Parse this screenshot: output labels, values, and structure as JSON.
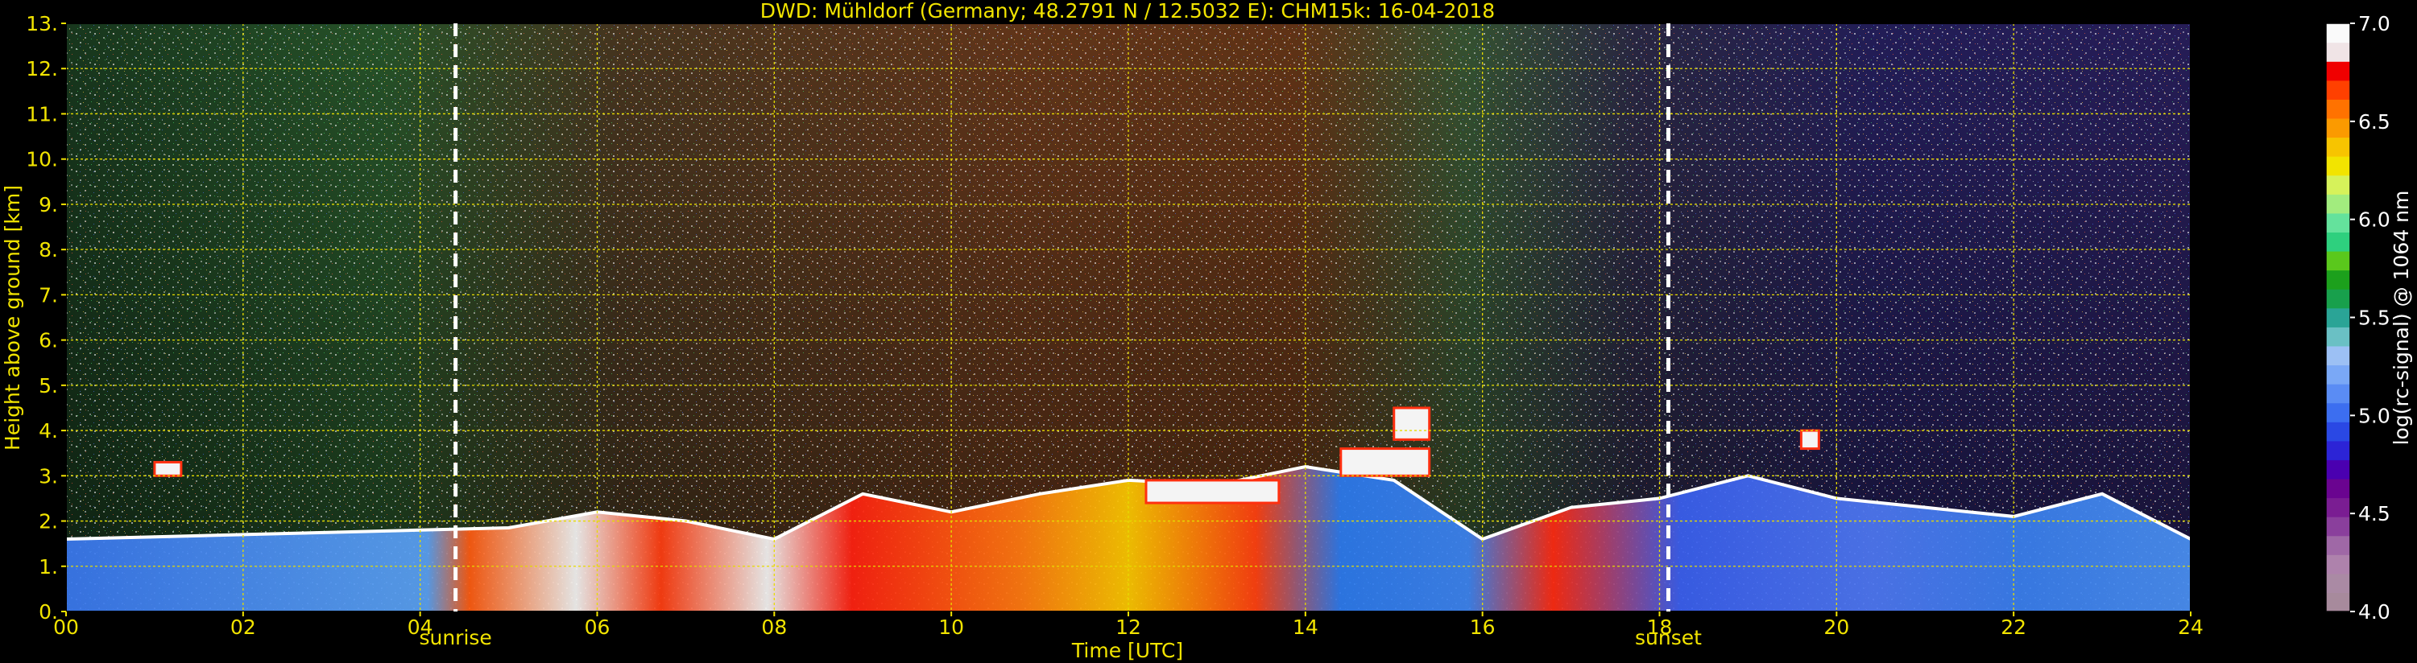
{
  "chart_data": {
    "type": "heatmap",
    "title": "DWD: Mühldorf (Germany; 48.2791 N / 12.5032 E):    CHM15k: 16-04-2018",
    "xlabel": "Time [UTC]",
    "ylabel": "Height above ground [km]",
    "xlim": [
      0,
      24
    ],
    "ylim": [
      0,
      13
    ],
    "x_ticks": [
      "00",
      "02",
      "04",
      "06",
      "08",
      "10",
      "12",
      "14",
      "16",
      "18",
      "20",
      "22",
      "24"
    ],
    "y_ticks": [
      "0.",
      "1.",
      "2.",
      "3.",
      "4.",
      "5.",
      "6.",
      "7.",
      "8.",
      "9.",
      "10.",
      "11.",
      "12.",
      "13."
    ],
    "grid": true,
    "events": [
      {
        "label": "sunrise",
        "time": 4.4
      },
      {
        "label": "sunset",
        "time": 18.1
      }
    ],
    "colorbar": {
      "label": "log(rc-signal) @ 1064 nm",
      "range": [
        4.0,
        7.0
      ],
      "ticks": [
        "4.0",
        "4.5",
        "5.0",
        "5.5",
        "6.0",
        "6.5",
        "7.0"
      ],
      "colors": [
        "#a78a9c",
        "#aa8aa4",
        "#ae82ac",
        "#9f68a6",
        "#8a3f9c",
        "#7a1d92",
        "#6a0490",
        "#4a00b0",
        "#2c24d6",
        "#2a48e4",
        "#3c6ef0",
        "#5a8cf4",
        "#7aa8f6",
        "#9cc0f4",
        "#6ac0c4",
        "#2aa496",
        "#18a04c",
        "#1ca01c",
        "#5ac81c",
        "#2ed07e",
        "#64e29c",
        "#a2ec7e",
        "#d6f25a",
        "#f2e400",
        "#f7c400",
        "#fb9a00",
        "#ff7200",
        "#ff4000",
        "#f00000",
        "#f0e4e6",
        "#fafafa"
      ]
    },
    "boundary_layer_top_km": [
      [
        0.0,
        1.6
      ],
      [
        1.0,
        1.65
      ],
      [
        2.0,
        1.7
      ],
      [
        3.0,
        1.75
      ],
      [
        4.0,
        1.8
      ],
      [
        5.0,
        1.85
      ],
      [
        6.0,
        2.2
      ],
      [
        7.0,
        2.0
      ],
      [
        8.0,
        1.6
      ],
      [
        9.0,
        2.6
      ],
      [
        10.0,
        2.2
      ],
      [
        11.0,
        2.6
      ],
      [
        12.0,
        2.9
      ],
      [
        13.0,
        2.8
      ],
      [
        14.0,
        3.2
      ],
      [
        15.0,
        2.9
      ],
      [
        16.0,
        1.6
      ],
      [
        17.0,
        2.3
      ],
      [
        18.0,
        2.5
      ],
      [
        19.0,
        3.0
      ],
      [
        20.0,
        2.5
      ],
      [
        21.0,
        2.3
      ],
      [
        22.0,
        2.1
      ],
      [
        23.0,
        2.6
      ],
      [
        24.0,
        1.6
      ]
    ],
    "cloud_layers": [
      {
        "from": 1.0,
        "to": 1.3,
        "base_km": 3.0,
        "top_km": 3.3
      },
      {
        "from": 12.2,
        "to": 13.7,
        "base_km": 2.4,
        "top_km": 2.9
      },
      {
        "from": 14.4,
        "to": 15.4,
        "base_km": 3.0,
        "top_km": 3.6
      },
      {
        "from": 15.0,
        "to": 15.4,
        "base_km": 3.8,
        "top_km": 4.5
      },
      {
        "from": 19.6,
        "to": 19.8,
        "base_km": 3.6,
        "top_km": 4.0
      }
    ]
  }
}
